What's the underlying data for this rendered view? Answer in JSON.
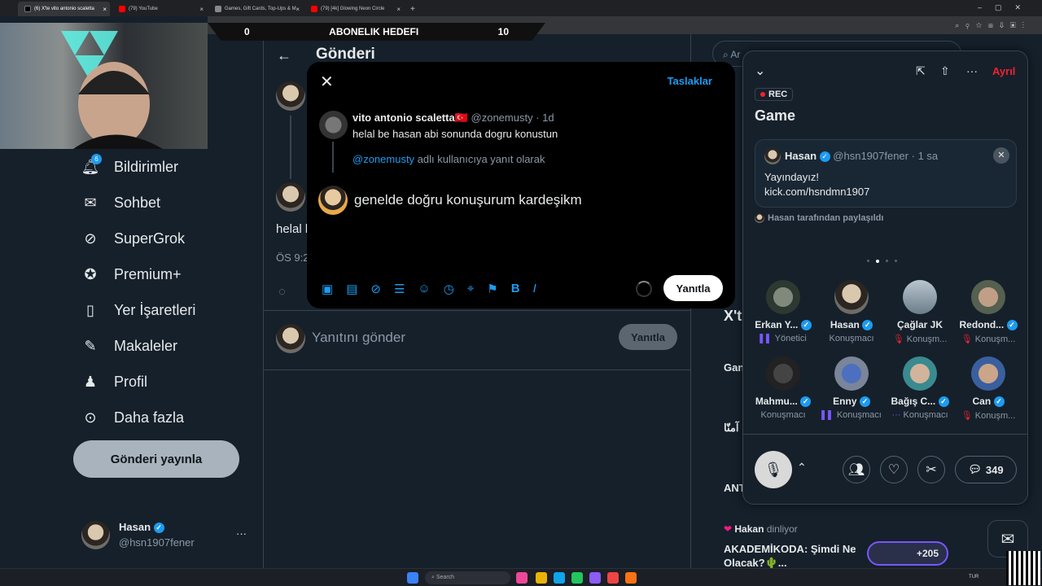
{
  "browser": {
    "tabs": [
      {
        "title": "(6) X'te vito antonio scaletta"
      },
      {
        "title": "(79) YouTube"
      },
      {
        "title": "Games, Gift Cards, Top-Ups & M"
      },
      {
        "title": "(79) [4k] Glowing Neon Circle"
      }
    ],
    "new_tab": "+"
  },
  "overlay": {
    "goal_left": "0",
    "goal_title": "ABONELIK HEDEFI",
    "goal_right": "10"
  },
  "sidebar": {
    "items": [
      {
        "label": "Bildirimler",
        "icon": "bell-icon",
        "badge": "6"
      },
      {
        "label": "Sohbet",
        "icon": "mail-icon"
      },
      {
        "label": "SuperGrok",
        "icon": "grok-icon"
      },
      {
        "label": "Premium+",
        "icon": "verified-icon"
      },
      {
        "label": "Yer İşaretleri",
        "icon": "bookmark-icon"
      },
      {
        "label": "Makaleler",
        "icon": "article-icon"
      },
      {
        "label": "Profil",
        "icon": "person-icon"
      },
      {
        "label": "Daha fazla",
        "icon": "more-icon"
      }
    ],
    "publish_button": "Gönderi yayınla",
    "account": {
      "name": "Hasan",
      "handle": "@hsn1907fener",
      "more": "···"
    }
  },
  "main": {
    "title": "Gönderi",
    "post_text_partial": "helal b",
    "time_partial": "ÖS 9:2",
    "reply_placeholder": "Yanıtını gönder",
    "reply_button": "Yanıtla"
  },
  "modal": {
    "drafts": "Taslaklar",
    "quoted": {
      "name": "vito antonio scaletta",
      "flag": "🇹🇷",
      "handle": "@zonemusty",
      "time": "· 1d",
      "text": "helal be hasan abi sonunda dogru konustun"
    },
    "reply_to_handle": "@zonemusty",
    "reply_to_text": "adlı kullanıcıya yanıt olarak",
    "compose_text": "genelde doğru konuşurum kardeşikm",
    "submit": "Yanıtla"
  },
  "right": {
    "search_partial": "Ar",
    "heading_partial": "X't",
    "snippets": [
      {
        "text": "Gan"
      },
      {
        "text": "آمنّا"
      },
      {
        "text": "ANT"
      }
    ],
    "listener": {
      "name": "Hakan",
      "suffix": "dinliyor"
    },
    "space_title": "AKADEMİKODA: Şimdi Ne Olacak?🌵...",
    "listener_count": "+205"
  },
  "space": {
    "leave": "Ayrıl",
    "rec": "REC",
    "title": "Game",
    "pinned": {
      "name": "Hasan",
      "handle": "@hsn1907fener",
      "time": "· 1 sa",
      "line1": "Yayındayız!",
      "line2": "kick.com/hsndmn1907"
    },
    "shared_by": "Hasan tarafından paylaşıldı",
    "participants": [
      {
        "name": "Erkan Y...",
        "role": "Yönetici",
        "verified": true
      },
      {
        "name": "Hasan",
        "role": "Konuşmacı",
        "verified": true
      },
      {
        "name": "Çağlar JK",
        "role": "Konuşm...",
        "verified": false
      },
      {
        "name": "Redond...",
        "role": "Konuşm...",
        "verified": true
      },
      {
        "name": "Mahmu...",
        "role": "Konuşmacı",
        "verified": true
      },
      {
        "name": "Enny",
        "role": "Konuşmacı",
        "verified": true
      },
      {
        "name": "Bağış C...",
        "role": "Konuşmacı",
        "verified": true
      },
      {
        "name": "Can",
        "role": "Konuşm...",
        "verified": true
      }
    ],
    "comments_count": "349"
  },
  "taskbar": {
    "search": "Search",
    "lang": "TUR"
  },
  "colors": {
    "accent": "#1d9bf0",
    "bg": "#15202b",
    "leave": "#f4212e"
  }
}
